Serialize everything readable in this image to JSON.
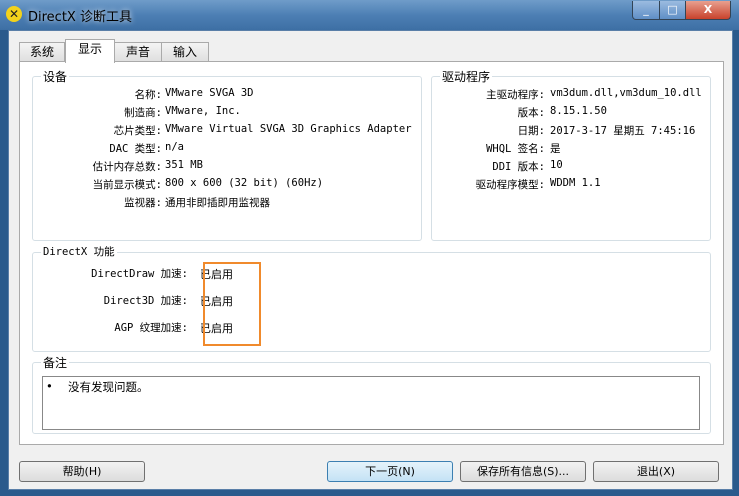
{
  "window": {
    "title": "DirectX 诊断工具",
    "min": "_",
    "max": "□",
    "close": "X"
  },
  "tabs": [
    {
      "label": "系统"
    },
    {
      "label": "显示"
    },
    {
      "label": "声音"
    },
    {
      "label": "输入"
    }
  ],
  "device": {
    "title": "设备",
    "rows": [
      {
        "k": "名称:",
        "v": "VMware SVGA 3D"
      },
      {
        "k": "制造商:",
        "v": "VMware, Inc."
      },
      {
        "k": "芯片类型:",
        "v": "VMware Virtual SVGA 3D Graphics Adapter"
      },
      {
        "k": "DAC 类型:",
        "v": "n/a"
      },
      {
        "k": "估计内存总数:",
        "v": "351 MB"
      },
      {
        "k": "当前显示模式:",
        "v": "800 x 600 (32 bit) (60Hz)"
      },
      {
        "k": "监视器:",
        "v": "通用非即插即用监视器"
      }
    ]
  },
  "driver": {
    "title": "驱动程序",
    "rows": [
      {
        "k": "主驱动程序:",
        "v": "vm3dum.dll,vm3dum_10.dll"
      },
      {
        "k": "版本:",
        "v": "8.15.1.50"
      },
      {
        "k": "日期:",
        "v": "2017-3-17 星期五 7:45:16"
      },
      {
        "k": "WHQL 签名:",
        "v": "是"
      },
      {
        "k": "DDI 版本:",
        "v": "10"
      },
      {
        "k": "驱动程序模型:",
        "v": "WDDM 1.1"
      }
    ]
  },
  "directx": {
    "title": "DirectX 功能",
    "rows": [
      {
        "k": "DirectDraw 加速:",
        "v": "已启用"
      },
      {
        "k": "Direct3D 加速:",
        "v": "已启用"
      },
      {
        "k": "AGP 纹理加速:",
        "v": "已启用"
      }
    ],
    "highlight": "#f08a2c"
  },
  "notes": {
    "title": "备注",
    "text": "没有发现问题。"
  },
  "buttons": {
    "help": "帮助(H)",
    "next": "下一页(N)",
    "save": "保存所有信息(S)...",
    "exit": "退出(X)"
  }
}
